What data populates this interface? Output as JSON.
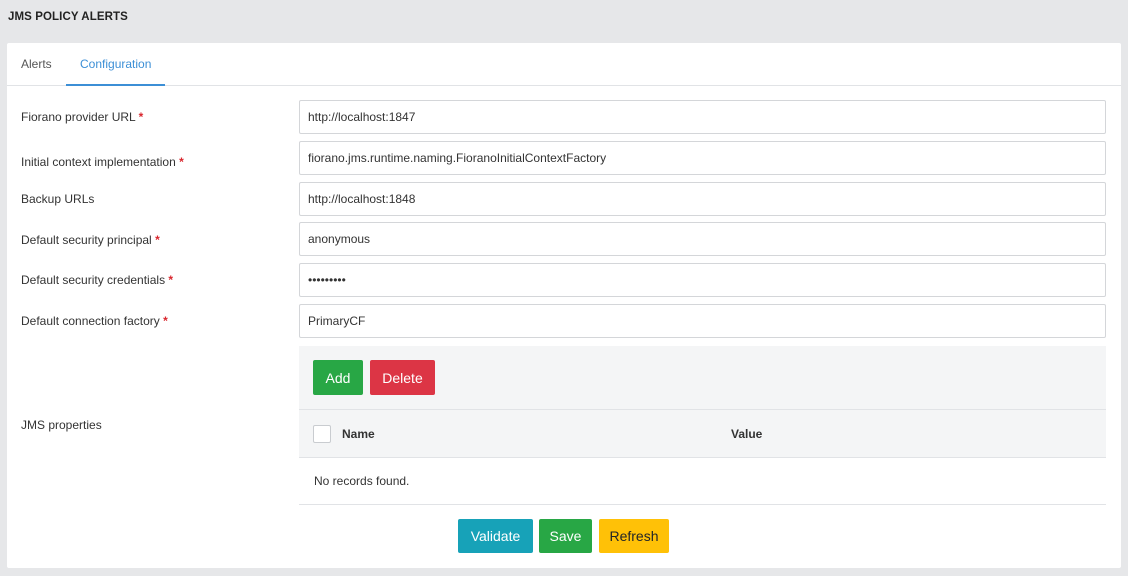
{
  "page": {
    "title": "JMS POLICY ALERTS"
  },
  "tabs": {
    "alerts": "Alerts",
    "configuration": "Configuration"
  },
  "form": {
    "provider_url": {
      "label": "Fiorano provider URL",
      "required": "*",
      "value": "http://localhost:1847"
    },
    "initial_context": {
      "label": "Initial context implementation",
      "required": "*",
      "value": "fiorano.jms.runtime.naming.FioranoInitialContextFactory"
    },
    "backup_urls": {
      "label": "Backup URLs",
      "value": "http://localhost:1848"
    },
    "security_principal": {
      "label": "Default security principal",
      "required": "*",
      "value": "anonymous"
    },
    "security_credentials": {
      "label": "Default security credentials",
      "required": "*",
      "value": "anonymous"
    },
    "connection_factory": {
      "label": "Default connection factory",
      "required": "*",
      "value": "PrimaryCF"
    },
    "jms_properties": {
      "label": "JMS properties"
    }
  },
  "props": {
    "add_label": "Add",
    "delete_label": "Delete",
    "columns": {
      "name": "Name",
      "value": "Value"
    },
    "empty_text": "No records found."
  },
  "actions": {
    "validate": "Validate",
    "save": "Save",
    "refresh": "Refresh"
  },
  "colors": {
    "accent": "#3c8fd6",
    "success": "#28a745",
    "danger": "#dc3545",
    "info": "#17a2b8",
    "warning": "#ffc107",
    "required": "#d9272e"
  }
}
